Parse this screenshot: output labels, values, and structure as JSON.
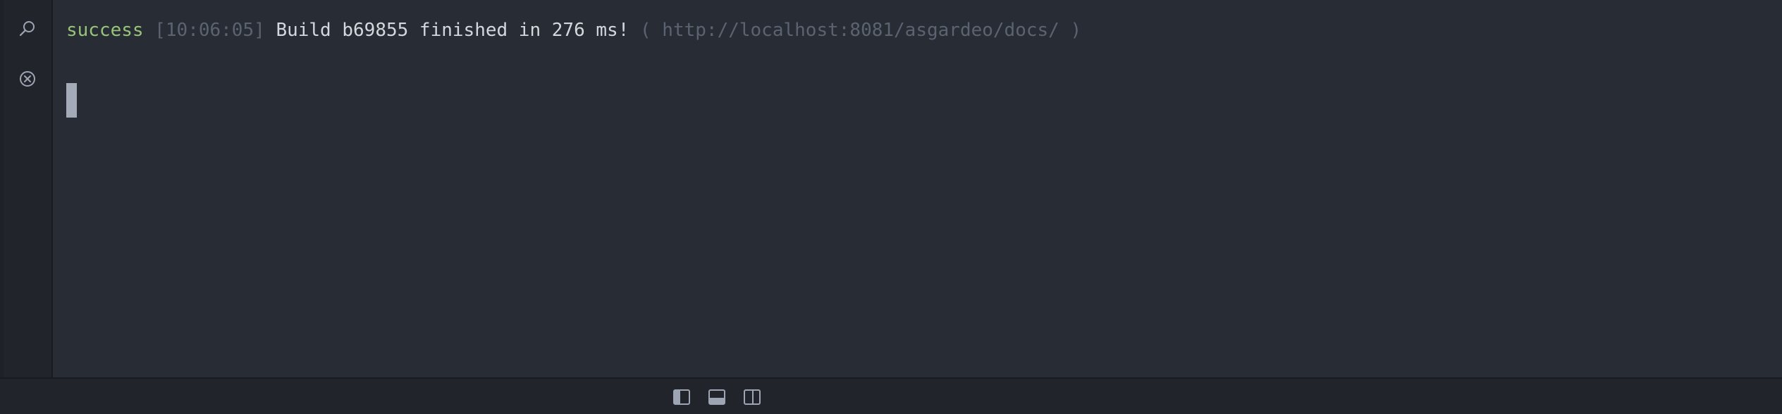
{
  "icons": {
    "search": "search-icon",
    "clear": "circle-x-icon",
    "left_panel": "left-panel-icon",
    "bottom_panel": "bottom-panel-icon",
    "right_panel": "right-panel-icon"
  },
  "terminal": {
    "output_line": {
      "status": "success",
      "timestamp": "[10:06:05]",
      "message": "Build b69855 finished in 276 ms!",
      "url": "( http://localhost:8081/asgardeo/docs/ )"
    }
  },
  "colors": {
    "background": "#282c34",
    "gutter": "#21252b",
    "success": "#98c379",
    "muted": "#5c6370",
    "text": "#d3d7de",
    "cursor": "#a4abb8"
  }
}
